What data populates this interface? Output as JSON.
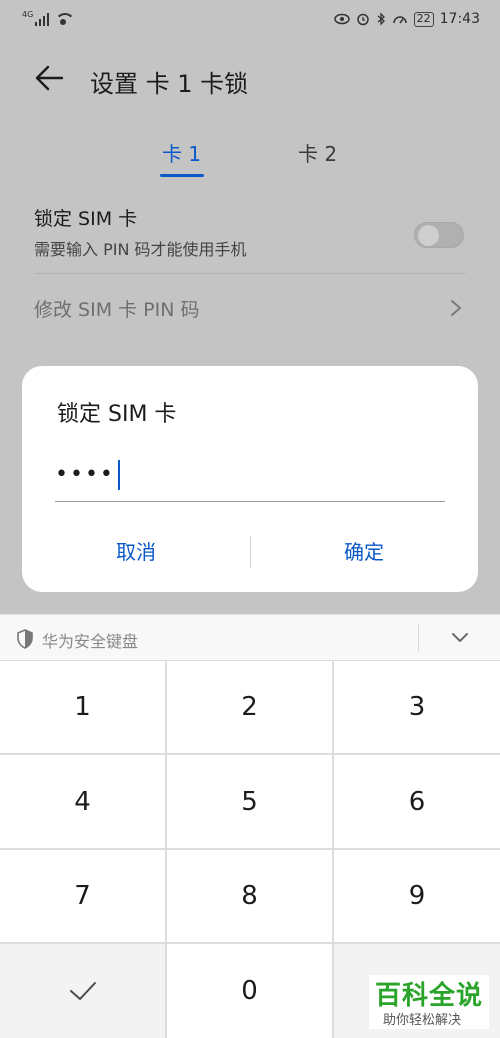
{
  "status_bar": {
    "network_label": "4G",
    "battery_level": "22",
    "time": "17:43"
  },
  "header": {
    "title": "设置 卡 1 卡锁"
  },
  "tabs": [
    {
      "label": "卡 1",
      "selected": true
    },
    {
      "label": "卡 2",
      "selected": false
    }
  ],
  "settings": {
    "lock_sim": {
      "title": "锁定 SIM 卡",
      "subtitle": "需要输入 PIN 码才能使用手机",
      "enabled": false
    },
    "change_pin": {
      "label": "修改 SIM 卡 PIN 码"
    }
  },
  "dialog": {
    "title": "锁定 SIM 卡",
    "pin_value": "••••",
    "cancel_label": "取消",
    "confirm_label": "确定"
  },
  "keyboard": {
    "name": "华为安全键盘",
    "keys": {
      "k1": "1",
      "k2": "2",
      "k3": "3",
      "k4": "4",
      "k5": "5",
      "k6": "6",
      "k7": "7",
      "k8": "8",
      "k9": "9",
      "k0": "0"
    }
  },
  "watermark": {
    "main": "百科全说",
    "sub": "助你轻松解决"
  },
  "colors": {
    "accent": "#0a59c8",
    "dim_background": "#c4c4c4",
    "watermark_green": "#2aa52a"
  }
}
